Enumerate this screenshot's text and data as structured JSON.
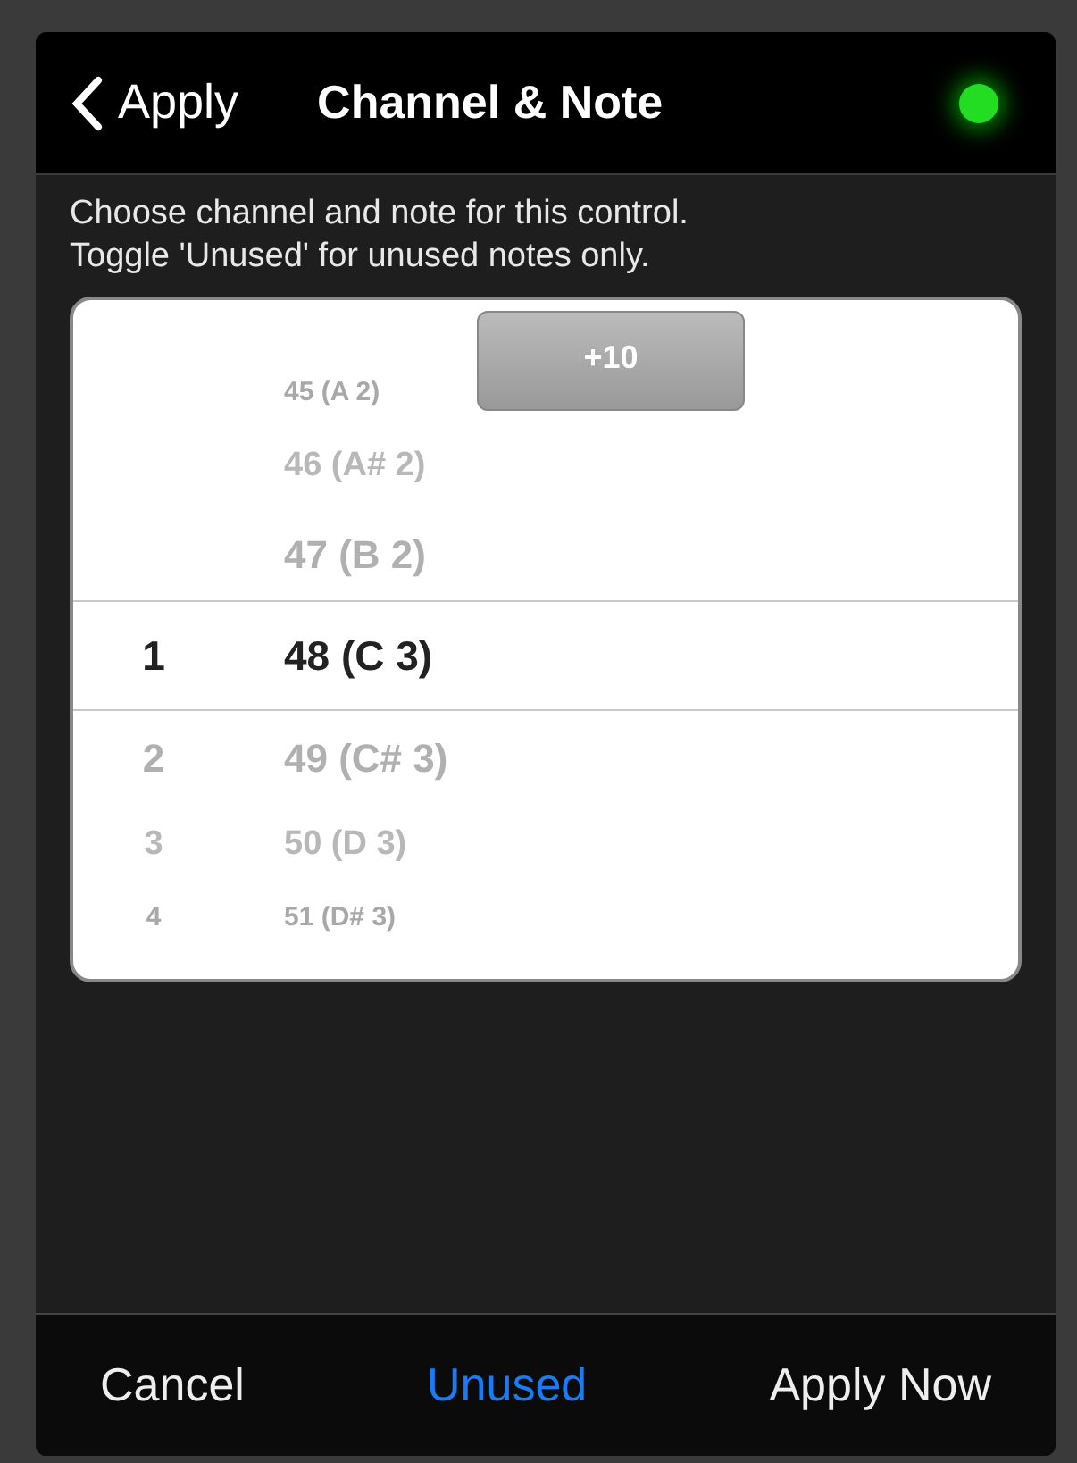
{
  "nav": {
    "back": "Apply",
    "title": "Channel & Note",
    "indicator_on": true
  },
  "description": "Choose channel and note for this control.\nToggle 'Unused' for unused notes only.",
  "picker": {
    "jump_button": "+10",
    "rows": [
      {
        "channel": "",
        "note": "45 (A 2)",
        "selected": false
      },
      {
        "channel": "",
        "note": "46 (A# 2)",
        "selected": false
      },
      {
        "channel": "",
        "note": "47 (B 2)",
        "selected": false
      },
      {
        "channel": "1",
        "note": "48 (C 3)",
        "selected": true
      },
      {
        "channel": "2",
        "note": "49 (C# 3)",
        "selected": false
      },
      {
        "channel": "3",
        "note": "50 (D 3)",
        "selected": false
      },
      {
        "channel": "4",
        "note": "51 (D# 3)",
        "selected": false
      }
    ]
  },
  "toolbar": [
    {
      "label": "Cancel",
      "on": false
    },
    {
      "label": "Unused",
      "on": true
    },
    {
      "label": "Apply Now",
      "on": false
    }
  ]
}
